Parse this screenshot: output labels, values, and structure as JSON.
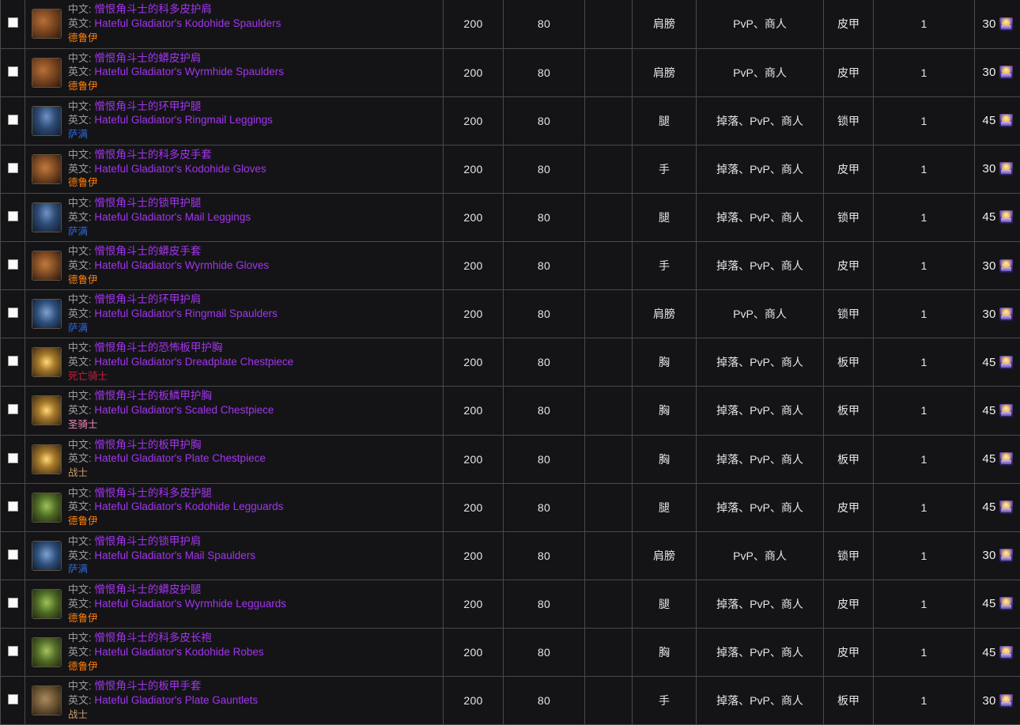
{
  "table": {
    "labels": {
      "cn_prefix": "中文:",
      "en_prefix": "英文:"
    },
    "class_colors": {
      "德鲁伊": "#ff7d0a",
      "萨满": "#2f68d6",
      "死亡骑士": "#c41f3b",
      "圣骑士": "#f58cba",
      "战士": "#c79c6e"
    },
    "item_name_color": "#a335ee",
    "currency_icon": "arena-points-icon",
    "rows": [
      {
        "checkbox": false,
        "icon": "shoulder-leather-brown-icon",
        "name_cn": "憎恨角斗士的科多皮护肩",
        "name_en": "Hateful Gladiator's Kodohide Spaulders",
        "klass": "德鲁伊",
        "klass_key": "druid",
        "ilvl": "200",
        "req_level": "80",
        "blank": "",
        "slot": "肩膀",
        "source": "PvP、商人",
        "armor": "皮甲",
        "qty": "1",
        "cost": "30"
      },
      {
        "checkbox": false,
        "icon": "shoulder-leather-brown-icon",
        "name_cn": "憎恨角斗士的蟒皮护肩",
        "name_en": "Hateful Gladiator's Wyrmhide Spaulders",
        "klass": "德鲁伊",
        "klass_key": "druid",
        "ilvl": "200",
        "req_level": "80",
        "blank": "",
        "slot": "肩膀",
        "source": "PvP、商人",
        "armor": "皮甲",
        "qty": "1",
        "cost": "30"
      },
      {
        "checkbox": false,
        "icon": "legs-mail-blue-icon",
        "name_cn": "憎恨角斗士的环甲护腿",
        "name_en": "Hateful Gladiator's Ringmail Leggings",
        "klass": "萨满",
        "klass_key": "shaman",
        "ilvl": "200",
        "req_level": "80",
        "blank": "",
        "slot": "腿",
        "source": "掉落、PvP、商人",
        "armor": "锁甲",
        "qty": "1",
        "cost": "45"
      },
      {
        "checkbox": false,
        "icon": "gloves-leather-brown-icon",
        "name_cn": "憎恨角斗士的科多皮手套",
        "name_en": "Hateful Gladiator's Kodohide Gloves",
        "klass": "德鲁伊",
        "klass_key": "druid",
        "ilvl": "200",
        "req_level": "80",
        "blank": "",
        "slot": "手",
        "source": "掉落、PvP、商人",
        "armor": "皮甲",
        "qty": "1",
        "cost": "30"
      },
      {
        "checkbox": false,
        "icon": "legs-mail-blue-icon",
        "name_cn": "憎恨角斗士的锁甲护腿",
        "name_en": "Hateful Gladiator's Mail Leggings",
        "klass": "萨满",
        "klass_key": "shaman",
        "ilvl": "200",
        "req_level": "80",
        "blank": "",
        "slot": "腿",
        "source": "掉落、PvP、商人",
        "armor": "锁甲",
        "qty": "1",
        "cost": "45"
      },
      {
        "checkbox": false,
        "icon": "gloves-leather-brown-icon",
        "name_cn": "憎恨角斗士的蟒皮手套",
        "name_en": "Hateful Gladiator's Wyrmhide Gloves",
        "klass": "德鲁伊",
        "klass_key": "druid",
        "ilvl": "200",
        "req_level": "80",
        "blank": "",
        "slot": "手",
        "source": "掉落、PvP、商人",
        "armor": "皮甲",
        "qty": "1",
        "cost": "30"
      },
      {
        "checkbox": false,
        "icon": "shoulder-mail-blue-icon",
        "name_cn": "憎恨角斗士的环甲护肩",
        "name_en": "Hateful Gladiator's Ringmail Spaulders",
        "klass": "萨满",
        "klass_key": "shaman",
        "ilvl": "200",
        "req_level": "80",
        "blank": "",
        "slot": "肩膀",
        "source": "PvP、商人",
        "armor": "锁甲",
        "qty": "1",
        "cost": "30"
      },
      {
        "checkbox": false,
        "icon": "chest-plate-gold-icon",
        "name_cn": "憎恨角斗士的恐怖板甲护胸",
        "name_en": "Hateful Gladiator's Dreadplate Chestpiece",
        "klass": "死亡骑士",
        "klass_key": "dk",
        "ilvl": "200",
        "req_level": "80",
        "blank": "",
        "slot": "胸",
        "source": "掉落、PvP、商人",
        "armor": "板甲",
        "qty": "1",
        "cost": "45"
      },
      {
        "checkbox": false,
        "icon": "chest-plate-gold-icon",
        "name_cn": "憎恨角斗士的板鳞甲护胸",
        "name_en": "Hateful Gladiator's Scaled Chestpiece",
        "klass": "圣骑士",
        "klass_key": "paladin",
        "ilvl": "200",
        "req_level": "80",
        "blank": "",
        "slot": "胸",
        "source": "掉落、PvP、商人",
        "armor": "板甲",
        "qty": "1",
        "cost": "45"
      },
      {
        "checkbox": false,
        "icon": "chest-plate-gold-icon",
        "name_cn": "憎恨角斗士的板甲护胸",
        "name_en": "Hateful Gladiator's Plate Chestpiece",
        "klass": "战士",
        "klass_key": "warrior",
        "ilvl": "200",
        "req_level": "80",
        "blank": "",
        "slot": "胸",
        "source": "掉落、PvP、商人",
        "armor": "板甲",
        "qty": "1",
        "cost": "45"
      },
      {
        "checkbox": false,
        "icon": "legs-leather-green-icon",
        "name_cn": "憎恨角斗士的科多皮护腿",
        "name_en": "Hateful Gladiator's Kodohide Legguards",
        "klass": "德鲁伊",
        "klass_key": "druid",
        "ilvl": "200",
        "req_level": "80",
        "blank": "",
        "slot": "腿",
        "source": "掉落、PvP、商人",
        "armor": "皮甲",
        "qty": "1",
        "cost": "45"
      },
      {
        "checkbox": false,
        "icon": "shoulder-mail-blue-icon",
        "name_cn": "憎恨角斗士的锁甲护肩",
        "name_en": "Hateful Gladiator's Mail Spaulders",
        "klass": "萨满",
        "klass_key": "shaman",
        "ilvl": "200",
        "req_level": "80",
        "blank": "",
        "slot": "肩膀",
        "source": "PvP、商人",
        "armor": "锁甲",
        "qty": "1",
        "cost": "30"
      },
      {
        "checkbox": false,
        "icon": "legs-leather-green-icon",
        "name_cn": "憎恨角斗士的蟒皮护腿",
        "name_en": "Hateful Gladiator's Wyrmhide Legguards",
        "klass": "德鲁伊",
        "klass_key": "druid",
        "ilvl": "200",
        "req_level": "80",
        "blank": "",
        "slot": "腿",
        "source": "掉落、PvP、商人",
        "armor": "皮甲",
        "qty": "1",
        "cost": "45"
      },
      {
        "checkbox": false,
        "icon": "chest-leather-green-icon",
        "name_cn": "憎恨角斗士的科多皮长袍",
        "name_en": "Hateful Gladiator's Kodohide Robes",
        "klass": "德鲁伊",
        "klass_key": "druid",
        "ilvl": "200",
        "req_level": "80",
        "blank": "",
        "slot": "胸",
        "source": "掉落、PvP、商人",
        "armor": "皮甲",
        "qty": "1",
        "cost": "45"
      },
      {
        "checkbox": false,
        "icon": "gloves-plate-bronze-icon",
        "name_cn": "憎恨角斗士的板甲手套",
        "name_en": "Hateful Gladiator's Plate Gauntlets",
        "klass": "战士",
        "klass_key": "warrior",
        "ilvl": "200",
        "req_level": "80",
        "blank": "",
        "slot": "手",
        "source": "掉落、PvP、商人",
        "armor": "板甲",
        "qty": "1",
        "cost": "30"
      }
    ]
  }
}
